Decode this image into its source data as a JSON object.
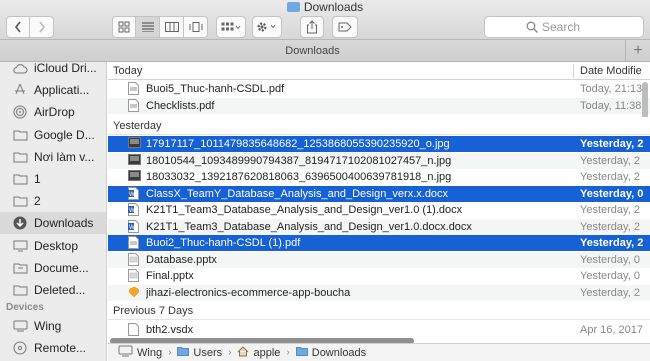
{
  "window": {
    "title": "Downloads"
  },
  "toolbar": {
    "search_placeholder": "Search"
  },
  "tabbar": {
    "label": "Downloads",
    "add": "+"
  },
  "sidebar": {
    "items": [
      {
        "label": "iCloud Dri...",
        "icon": "cloud-icon"
      },
      {
        "label": "Applicati...",
        "icon": "applications-icon"
      },
      {
        "label": "AirDrop",
        "icon": "airdrop-icon"
      },
      {
        "label": "Google D...",
        "icon": "folder-icon"
      },
      {
        "label": "Nơi làm v...",
        "icon": "folder-icon"
      },
      {
        "label": "1",
        "icon": "folder-icon"
      },
      {
        "label": "2",
        "icon": "folder-icon"
      },
      {
        "label": "Downloads",
        "icon": "download-icon",
        "active": true
      },
      {
        "label": "Desktop",
        "icon": "desktop-icon"
      },
      {
        "label": "Docume...",
        "icon": "document-folder-icon"
      },
      {
        "label": "Deleted...",
        "icon": "folder-icon"
      }
    ],
    "devices_header": "Devices",
    "devices": [
      {
        "label": "Wing",
        "icon": "computer-icon"
      },
      {
        "label": "Remote...",
        "icon": "disc-icon"
      }
    ]
  },
  "list": {
    "columns": {
      "name": "Today",
      "date": "Date Modifie"
    },
    "groups": [
      {
        "header": "",
        "rows": [
          {
            "name": "Buoi5_Thuc-hanh-CSDL.pdf",
            "date": "Today, 21:13",
            "icon": "pdf-icon"
          },
          {
            "name": "Checklists.pdf",
            "date": "Today, 11:38",
            "icon": "pdf-icon"
          }
        ]
      },
      {
        "header": "Yesterday",
        "rows": [
          {
            "name": "17917117_1011479835648682_1253868055390235920_o.jpg",
            "date": "Yesterday, 2",
            "icon": "image-icon",
            "selected": true
          },
          {
            "name": "18010544_1093489990794387_8194717102081027457_n.jpg",
            "date": "Yesterday, 2",
            "icon": "image-icon"
          },
          {
            "name": "18033032_1392187620818063_6396500400639781918_n.jpg",
            "date": "Yesterday, 2",
            "icon": "image-icon"
          },
          {
            "name": "ClassX_TeamY_Database_Analysis_and_Design_verx.x.docx",
            "date": "Yesterday, 0",
            "icon": "word-icon",
            "selected": true
          },
          {
            "name": "K21T1_Team3_Database_Analysis_and_Design_ver1.0 (1).docx",
            "date": "Yesterday, 2",
            "icon": "word-icon"
          },
          {
            "name": "K21T1_Team3_Database_Analysis_and_Design_ver1.0.docx.docx",
            "date": "Yesterday, 2",
            "icon": "word-icon"
          },
          {
            "name": "Buoi2_Thuc-hanh-CSDL (1).pdf",
            "date": "Yesterday, 2",
            "icon": "pdf-icon",
            "selected": true
          },
          {
            "name": "Database.pptx",
            "date": "Yesterday, 0",
            "icon": "pptx-icon"
          },
          {
            "name": "Final.pptx",
            "date": "Yesterday, 0",
            "icon": "pptx-icon"
          },
          {
            "name": "jihazi-electronics-ecommerce-app-boucha",
            "date": "Yesterday, 2",
            "icon": "sketch-icon"
          }
        ]
      },
      {
        "header": "Previous 7 Days",
        "rows": [
          {
            "name": "bth2.vsdx",
            "date": "Apr 16, 2017",
            "icon": "doc-icon"
          }
        ]
      }
    ]
  },
  "pathbar": {
    "crumbs": [
      {
        "label": "Wing",
        "icon": "computer-icon"
      },
      {
        "label": "Users",
        "icon": "folder-icon"
      },
      {
        "label": "apple",
        "icon": "home-icon"
      },
      {
        "label": "Downloads",
        "icon": "folder-icon"
      }
    ]
  },
  "colors": {
    "selection": "#1661d6",
    "folder": "#6ea9e0"
  }
}
